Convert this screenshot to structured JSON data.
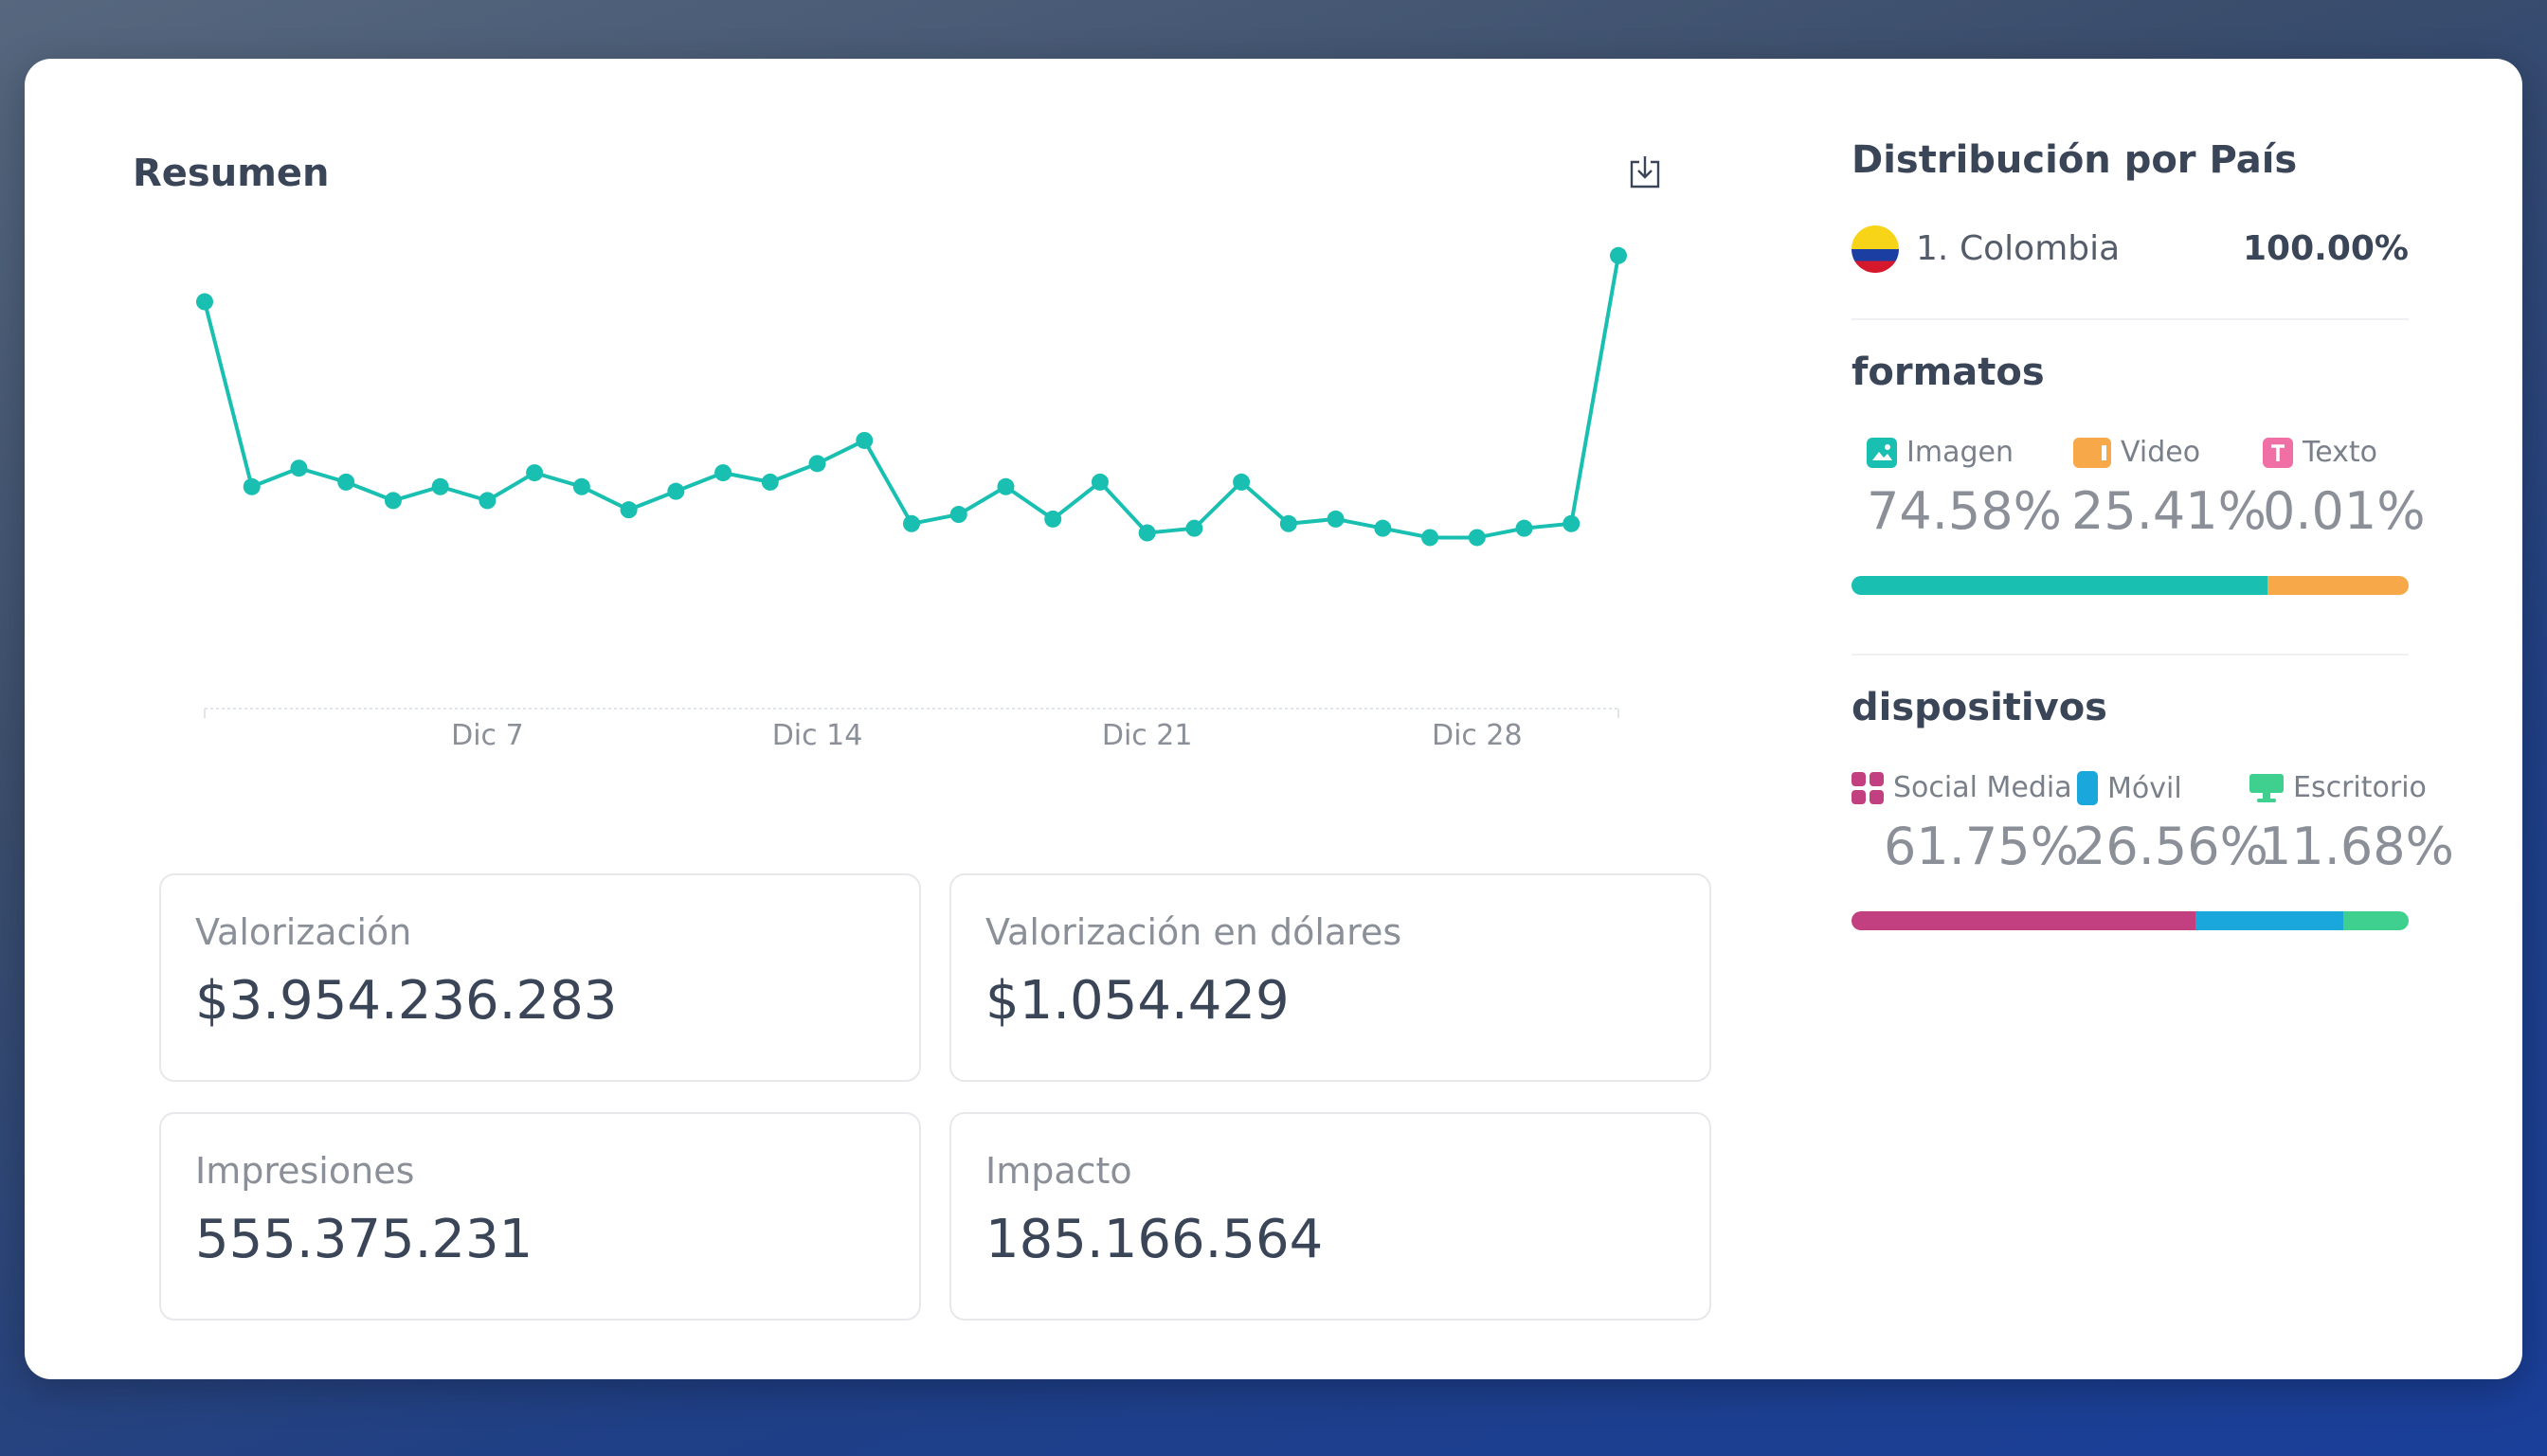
{
  "summary": {
    "title": "Resumen",
    "download_icon": "download-icon"
  },
  "chart_data": {
    "type": "line",
    "x_tick_labels": [
      "Dic 7",
      "Dic 14",
      "Dic 21",
      "Dic 28"
    ],
    "x_tick_index": [
      6,
      13,
      20,
      27
    ],
    "values": [
      88,
      48,
      52,
      49,
      45,
      48,
      45,
      51,
      48,
      43,
      47,
      51,
      49,
      53,
      58,
      40,
      42,
      48,
      41,
      49,
      38,
      39,
      49,
      40,
      41,
      39,
      37,
      37,
      39,
      40,
      98
    ],
    "ylim": [
      0,
      100
    ],
    "color": "#19bfb0",
    "grid": false
  },
  "stats": {
    "valorizacion": {
      "label": "Valorización",
      "value": "$3.954.236.283"
    },
    "valorizacion_usd": {
      "label": "Valorización en dólares",
      "value": "$1.054.429"
    },
    "impresiones": {
      "label": "Impresiones",
      "value": "555.375.231"
    },
    "impacto": {
      "label": "Impacto",
      "value": "185.166.564"
    }
  },
  "country": {
    "heading": "Distribución por País",
    "items": [
      {
        "rank": "1.",
        "name": "Colombia",
        "pct": "100.00%"
      }
    ]
  },
  "formatos": {
    "heading": "formatos",
    "items": [
      {
        "label": "Imagen",
        "pct": "74.58%",
        "share": 74.58,
        "color": "#19bfb0",
        "icon": "image-icon"
      },
      {
        "label": "Video",
        "pct": "25.41%",
        "share": 25.41,
        "color": "#f7a94a",
        "icon": "video-icon"
      },
      {
        "label": "Texto",
        "pct": "0.01%",
        "share": 0.01,
        "color": "#f06fa4",
        "icon": "text-icon"
      }
    ]
  },
  "dispositivos": {
    "heading": "dispositivos",
    "items": [
      {
        "label": "Social Media",
        "pct": "61.75%",
        "share": 61.75,
        "color": "#c2407f",
        "icon": "grid-icon"
      },
      {
        "label": "Móvil",
        "pct": "26.56%",
        "share": 26.56,
        "color": "#1aa7dc",
        "icon": "mobile-icon"
      },
      {
        "label": "Escritorio",
        "pct": "11.68%",
        "share": 11.68,
        "color": "#3fcf8e",
        "icon": "desktop-icon"
      }
    ]
  }
}
